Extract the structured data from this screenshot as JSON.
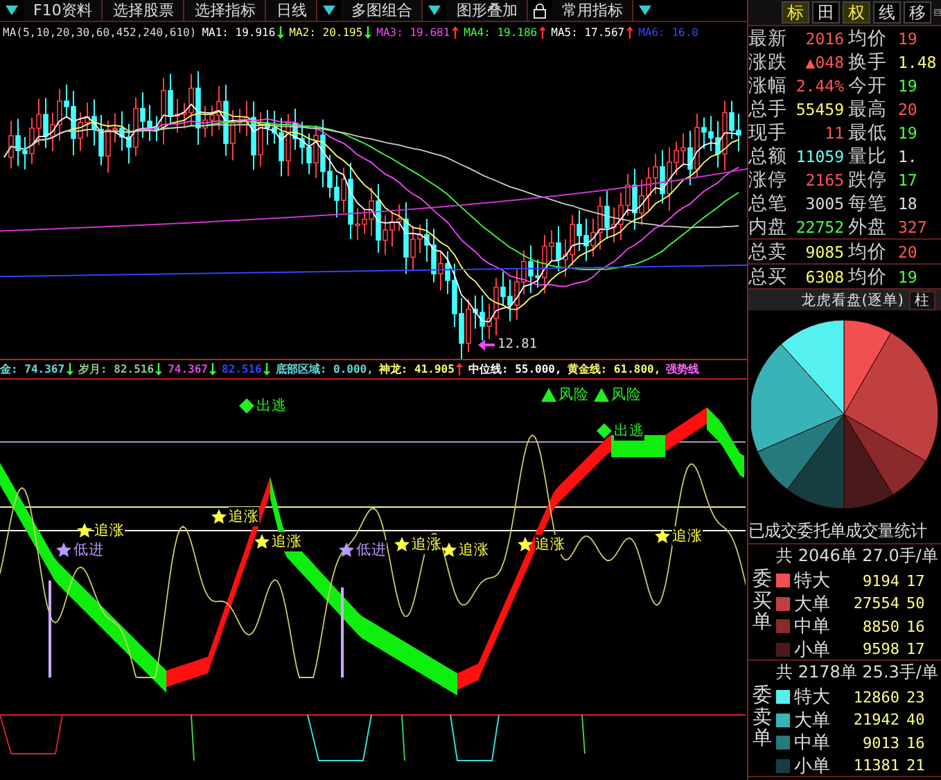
{
  "toolbar": {
    "items": [
      {
        "kind": "dropdown"
      },
      {
        "kind": "button",
        "label": "F10资料"
      },
      {
        "kind": "button",
        "label": "选择股票"
      },
      {
        "kind": "button",
        "label": "选择指标"
      },
      {
        "kind": "button",
        "label": "日线"
      },
      {
        "kind": "dropdown"
      },
      {
        "kind": "button",
        "label": "多图组合"
      },
      {
        "kind": "dropdown"
      },
      {
        "kind": "button",
        "label": "图形叠加"
      },
      {
        "kind": "lock"
      },
      {
        "kind": "button",
        "label": "常用指标"
      },
      {
        "kind": "dropdown"
      }
    ]
  },
  "ma_legend": {
    "title": "MA(5,10,20,30,60,452,240,610)",
    "items": [
      {
        "kind": "down",
        "label": "MA1:",
        "value": "19.916",
        "color": "#ffffff"
      },
      {
        "kind": "down",
        "label": "MA2:",
        "value": "20.195",
        "color": "#ffff66"
      },
      {
        "kind": "up",
        "label": "MA3:",
        "value": "19.681",
        "color": "#ff44ff"
      },
      {
        "kind": "up",
        "label": "MA4:",
        "value": "19.186",
        "color": "#44ff44"
      },
      {
        "kind": "up",
        "label": "MA5:",
        "value": "17.567",
        "color": "#ffffff"
      },
      {
        "kind": "plain",
        "label": "MA6:",
        "value": "16.0",
        "color": "#3344ff"
      }
    ]
  },
  "price_chart": {
    "low_label": "12.81"
  },
  "indicator_legend": {
    "items": [
      {
        "kind": "down",
        "text": "金: 74.367",
        "color": "#66dddd"
      },
      {
        "kind": "down",
        "text": "岁月: 82.516",
        "color": "#88cc88"
      },
      {
        "kind": "down",
        "text": "74.367",
        "color": "#dd44dd"
      },
      {
        "kind": "down",
        "text": "82.516",
        "color": "#3344ff"
      },
      {
        "kind": "plain",
        "text": "底部区域: 0.000,",
        "color": "#66dddd"
      },
      {
        "kind": "up",
        "text": "神龙: 41.905",
        "color": "#ffff66"
      },
      {
        "kind": "plain",
        "text": "中位线: 55.000,",
        "color": "#ffffff"
      },
      {
        "kind": "plain",
        "text": "黄金线: 61.800,",
        "color": "#ffff66"
      },
      {
        "kind": "plain",
        "text": "强势线",
        "color": "#ff66ff"
      }
    ]
  },
  "indicator_chart": {
    "markers": [
      {
        "kind": "diamond",
        "text": "出逃",
        "color": "#22ee22"
      },
      {
        "kind": "triangle",
        "text": "风险",
        "color": "#22ee22"
      },
      {
        "kind": "triangle",
        "text": "风险",
        "color": "#22ee22"
      },
      {
        "kind": "diamond",
        "text": "出逃",
        "color": "#22ee22"
      },
      {
        "kind": "star",
        "text": "追涨",
        "color": "#ffff44"
      },
      {
        "kind": "star",
        "text": "追涨",
        "color": "#ffff44"
      },
      {
        "kind": "star",
        "text": "追涨",
        "color": "#ffff44"
      },
      {
        "kind": "star",
        "text": "追涨",
        "color": "#ffff44"
      },
      {
        "kind": "star",
        "text": "追涨",
        "color": "#ffff44"
      },
      {
        "kind": "star",
        "text": "追涨",
        "color": "#ffff44"
      },
      {
        "kind": "star",
        "text": "追涨",
        "color": "#ffff44"
      },
      {
        "kind": "star",
        "text": "低进",
        "color": "#bb99ff"
      },
      {
        "kind": "star",
        "text": "低进",
        "color": "#bb99ff"
      }
    ]
  },
  "quote_panel": {
    "tabs": [
      {
        "label": "标",
        "selected": true
      },
      {
        "label": "田",
        "selected": false
      },
      {
        "label": "权",
        "selected": true
      },
      {
        "label": "线",
        "selected": false
      },
      {
        "label": "移",
        "selected": false
      }
    ],
    "rows": [
      {
        "left": {
          "label": "最新",
          "value": "2016",
          "color": "#ff5555"
        },
        "right": {
          "label": "均价",
          "value": "19",
          "color": "#ff5555"
        }
      },
      {
        "left": {
          "label": "涨跌",
          "value": "▲048",
          "color": "#ff5555"
        },
        "right": {
          "label": "换手",
          "value": "1.48",
          "color": "#ffff66"
        }
      },
      {
        "left": {
          "label": "涨幅",
          "value": "2.44%",
          "color": "#ff5555"
        },
        "right": {
          "label": "今开",
          "value": "19",
          "color": "#44ff44"
        }
      },
      {
        "left": {
          "label": "总手",
          "value": "55459",
          "color": "#ffff66"
        },
        "right": {
          "label": "最高",
          "value": "20",
          "color": "#ff5555"
        }
      },
      {
        "left": {
          "label": "现手",
          "value": "11",
          "color": "#ff5555"
        },
        "right": {
          "label": "最低",
          "value": "19",
          "color": "#44ff44"
        }
      },
      {
        "left": {
          "label": "总额",
          "value": "11059",
          "color": "#66ffff"
        },
        "right": {
          "label": "量比",
          "value": "1.",
          "color": "#dddddd"
        }
      },
      {
        "left": {
          "label": "涨停",
          "value": "2165",
          "color": "#ff5555"
        },
        "right": {
          "label": "跌停",
          "value": "17",
          "color": "#44ff44"
        }
      },
      {
        "left": {
          "label": "总笔",
          "value": "3005",
          "color": "#dddddd"
        },
        "right": {
          "label": "每笔",
          "value": "18",
          "color": "#dddddd"
        }
      },
      {
        "left": {
          "label": "内盘",
          "value": "22752",
          "color": "#44ff44"
        },
        "right": {
          "label": "外盘",
          "value": "327",
          "color": "#ff5555"
        }
      },
      {
        "left": {
          "label": "总卖",
          "value": "9085",
          "color": "#ffff66"
        },
        "right": {
          "label": "均价",
          "value": "20",
          "color": "#ff5555"
        }
      },
      {
        "left": {
          "label": "总买",
          "value": "6308",
          "color": "#ffff66"
        },
        "right": {
          "label": "均价",
          "value": "19",
          "color": "#44ff44"
        }
      }
    ]
  },
  "order_panel": {
    "title": "龙虎看盘(逐单)",
    "button": "柱",
    "chart_data": {
      "type": "pie",
      "values": [
        8.33,
        24.96,
        8.02,
        8.69,
        10.31,
        8.16,
        19.88,
        11.65
      ]
    },
    "stats_title": "已成交委托单成交量统计",
    "tables": [
      {
        "side": "委买单",
        "summary": "共 2046单 27.0手/单",
        "rows": [
          {
            "label": "特大",
            "volume": "9194",
            "share": "17",
            "color": "#f05050"
          },
          {
            "label": "大单",
            "volume": "27554",
            "share": "50",
            "color": "#c04040"
          },
          {
            "label": "中单",
            "volume": "8850",
            "share": "16",
            "color": "#8a2a2a"
          },
          {
            "label": "小单",
            "volume": "9598",
            "share": "17",
            "color": "#4a1a1a"
          }
        ]
      },
      {
        "side": "委卖单",
        "summary": "共 2178单 25.3手/单",
        "rows": [
          {
            "label": "特大",
            "volume": "12860",
            "share": "23",
            "color": "#55f0f0"
          },
          {
            "label": "大单",
            "volume": "21942",
            "share": "40",
            "color": "#38b4b8"
          },
          {
            "label": "中单",
            "volume": "9013",
            "share": "16",
            "color": "#257a7e"
          },
          {
            "label": "小单",
            "volume": "11381",
            "share": "21",
            "color": "#163e40"
          }
        ]
      }
    ]
  }
}
